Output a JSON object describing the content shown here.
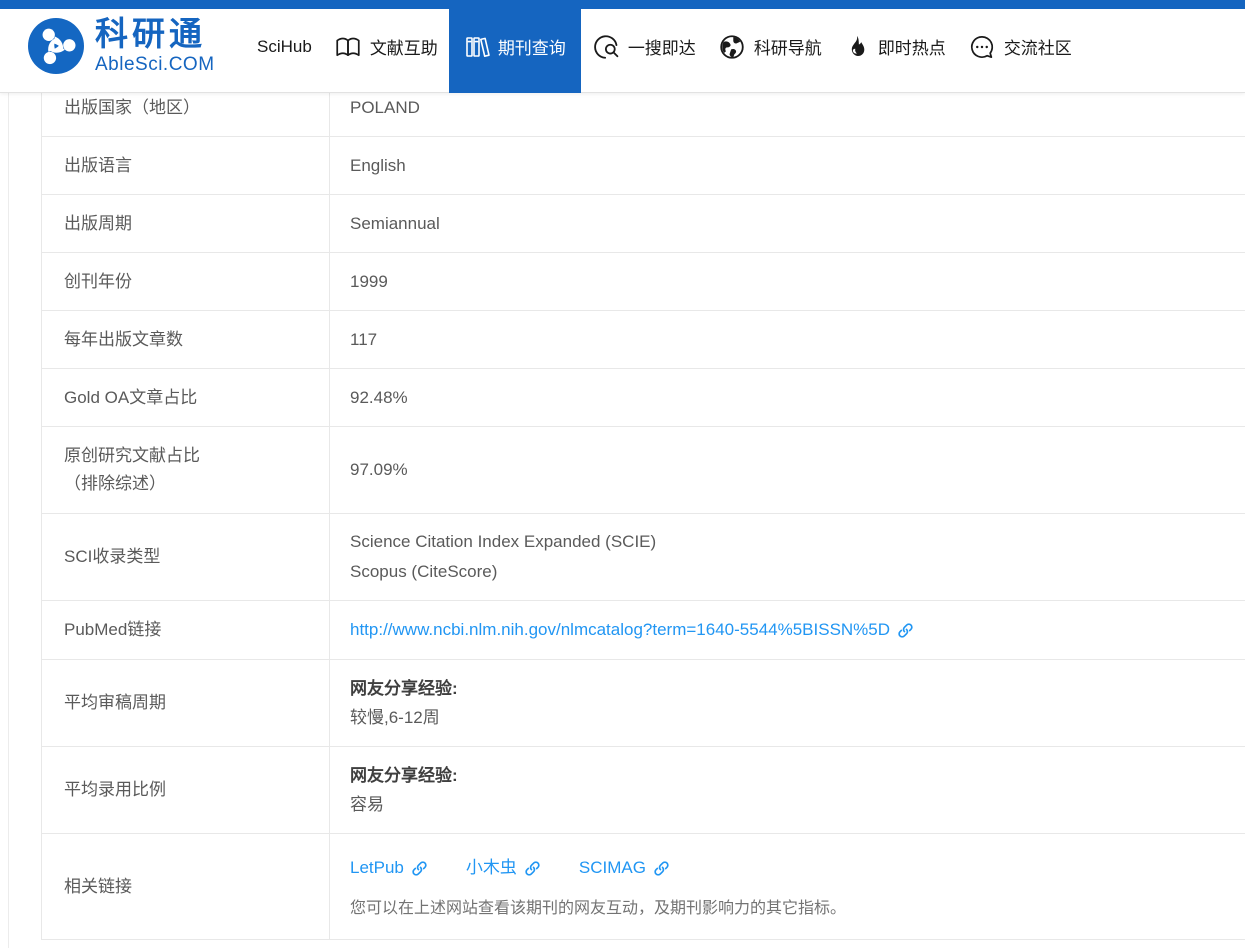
{
  "brand": {
    "name": "科研通",
    "domain": "AbleSci.COM"
  },
  "nav": {
    "items": [
      {
        "label": "SciHub",
        "icon": "none",
        "active": false
      },
      {
        "label": "文献互助",
        "icon": "open-book-icon",
        "active": false
      },
      {
        "label": "期刊查询",
        "icon": "journals-icon",
        "active": true
      },
      {
        "label": "一搜即达",
        "icon": "search-circle-icon",
        "active": false
      },
      {
        "label": "科研导航",
        "icon": "globe-icon",
        "active": false
      },
      {
        "label": "即时热点",
        "icon": "flame-icon",
        "active": false
      },
      {
        "label": "交流社区",
        "icon": "chat-bubble-icon",
        "active": false
      }
    ]
  },
  "colors": {
    "primary_blue": "#1565c0",
    "link_blue": "#2196f3",
    "text_gray": "#5a5a5a",
    "border_gray": "#e8e8e8"
  },
  "table": {
    "rows": [
      {
        "label": "出版国家（地区）",
        "value": "POLAND"
      },
      {
        "label": "出版语言",
        "value": "English"
      },
      {
        "label": "出版周期",
        "value": "Semiannual"
      },
      {
        "label": "创刊年份",
        "value": "1999"
      },
      {
        "label": "每年出版文章数",
        "value": "117"
      },
      {
        "label": "Gold OA文章占比",
        "value": "92.48%"
      },
      {
        "label": "原创研究文献占比",
        "label_line2": "（排除综述）",
        "value": "97.09%"
      },
      {
        "label": "SCI收录类型",
        "value_line1": "Science Citation Index Expanded (SCIE)",
        "value_line2": "Scopus (CiteScore)"
      },
      {
        "label": "PubMed链接",
        "link_text": "http://www.ncbi.nlm.nih.gov/nlmcatalog?term=1640-5544%5BISSN%5D"
      },
      {
        "label": "平均审稿周期",
        "prefix": "网友分享经验:",
        "value": "较慢,6-12周"
      },
      {
        "label": "平均录用比例",
        "prefix": "网友分享经验:",
        "value": "容易"
      },
      {
        "label": "相关链接",
        "links": [
          {
            "label": "LetPub"
          },
          {
            "label": "小木虫"
          },
          {
            "label": "SCIMAG"
          }
        ],
        "note": "您可以在上述网站查看该期刊的网友互动，及期刊影响力的其它指标。"
      }
    ]
  }
}
